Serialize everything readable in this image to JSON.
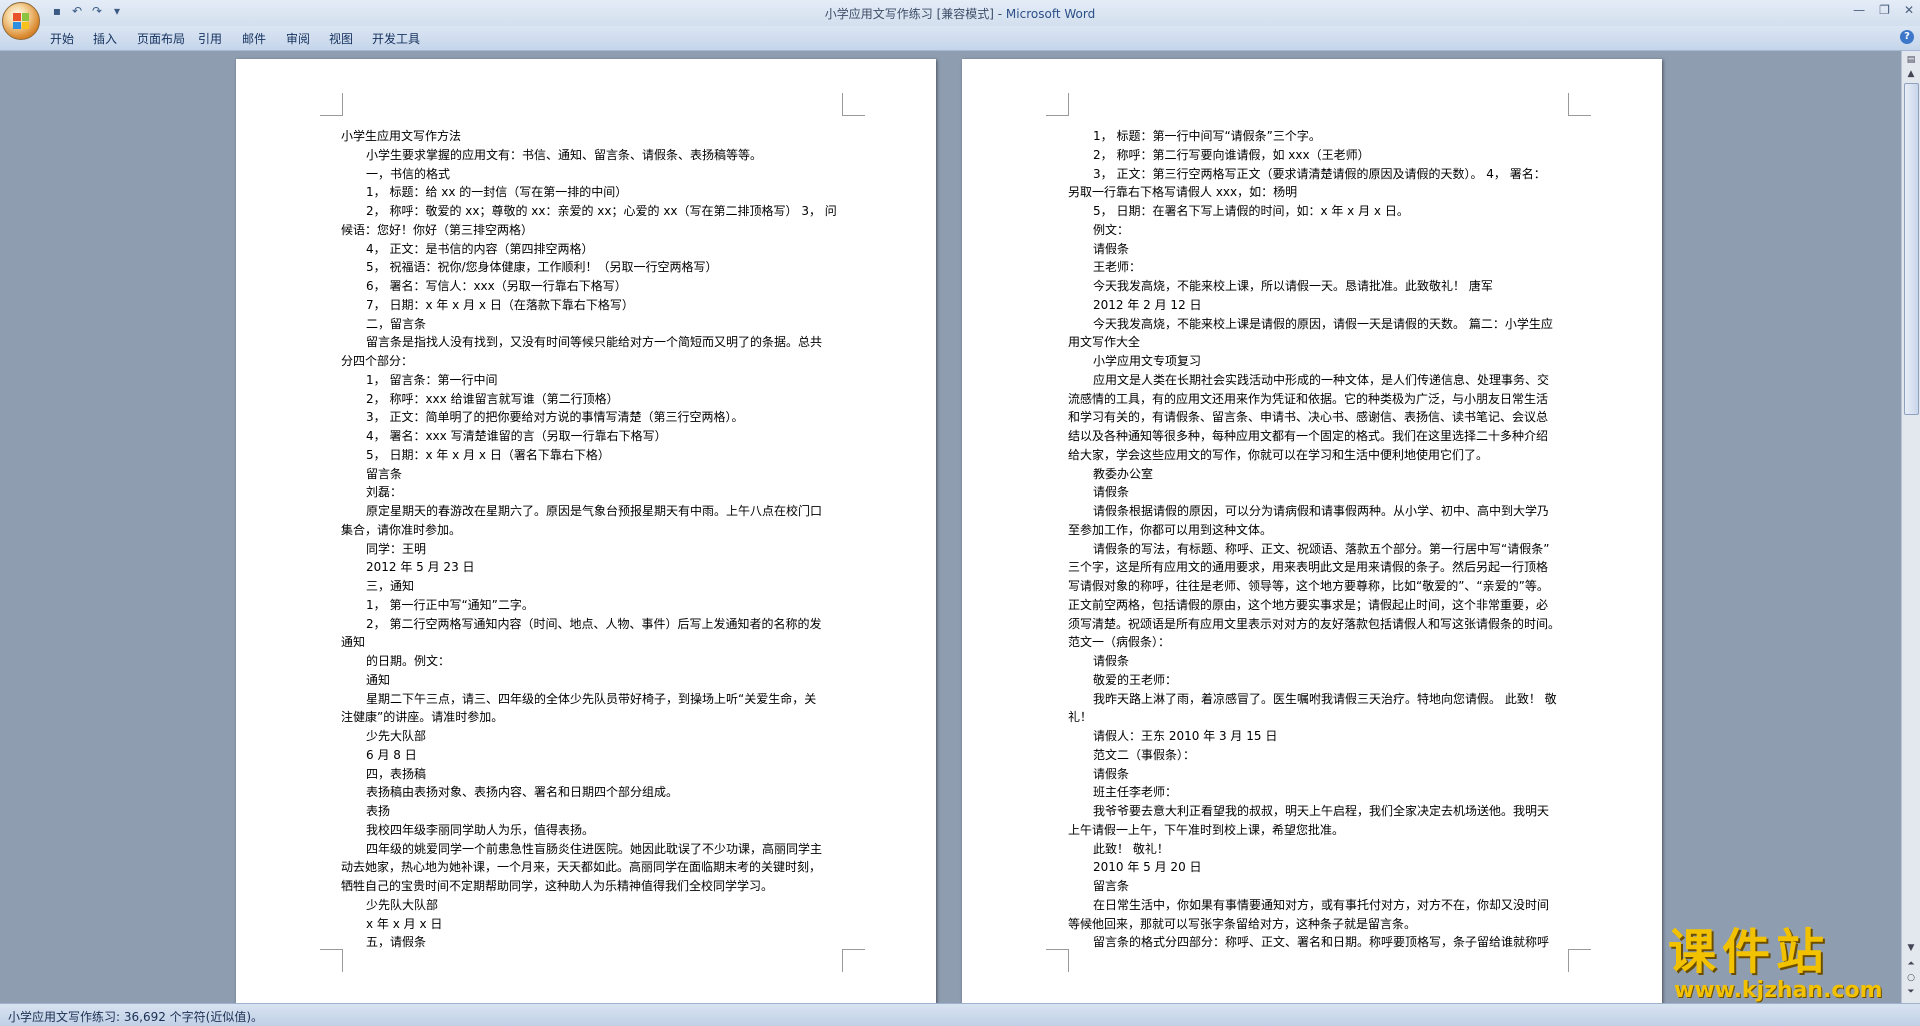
{
  "window": {
    "title_doc": "小学应用文写作练习 [兼容模式] - ",
    "title_app": "Microsoft Word"
  },
  "qat": {
    "save": "▪",
    "undo": "↶",
    "redo": "↷",
    "more": "▾"
  },
  "tabs": [
    "开始",
    "插入",
    "页面布局",
    "引用",
    "邮件",
    "审阅",
    "视图",
    "开发工具"
  ],
  "page1": [
    {
      "t": "小学生应用文写作方法",
      "c": ""
    },
    {
      "t": "小学生要求掌握的应用文有：书信、通知、留言条、请假条、表扬稿等等。",
      "c": "ind"
    },
    {
      "t": "一，书信的格式",
      "c": "ind"
    },
    {
      "t": "1， 标题：给 xx 的一封信（写在第一排的中间）",
      "c": "ind"
    },
    {
      "t": "2， 称呼：敬爱的 xx；尊敬的 xx：亲爱的 xx；心爱的 xx（写在第二排顶格写） 3， 问",
      "c": "ind"
    },
    {
      "t": "候语：您好！你好（第三排空两格）",
      "c": ""
    },
    {
      "t": "4， 正文：是书信的内容（第四排空两格）",
      "c": "ind"
    },
    {
      "t": "5， 祝福语：祝你/您身体健康，工作顺利！（另取一行空两格写）",
      "c": "ind"
    },
    {
      "t": "6， 署名：写信人：xxx（另取一行靠右下格写）",
      "c": "ind"
    },
    {
      "t": "7， 日期：x 年 x 月 x 日（在落款下靠右下格写）",
      "c": "ind"
    },
    {
      "t": "二，留言条",
      "c": "ind"
    },
    {
      "t": "留言条是指找人没有找到，又没有时间等候只能给对方一个简短而又明了的条据。总共",
      "c": "ind"
    },
    {
      "t": "分四个部分：",
      "c": ""
    },
    {
      "t": "1， 留言条：第一行中间",
      "c": "ind"
    },
    {
      "t": "2， 称呼：xxx 给谁留言就写谁（第二行顶格）",
      "c": "ind"
    },
    {
      "t": "3， 正文：简单明了的把你要给对方说的事情写清楚（第三行空两格）。",
      "c": "ind"
    },
    {
      "t": "4， 署名：xxx 写清楚谁留的言（另取一行靠右下格写）",
      "c": "ind"
    },
    {
      "t": "5， 日期：x 年 x 月 x 日（署名下靠右下格）",
      "c": "ind"
    },
    {
      "t": "留言条",
      "c": "ind"
    },
    {
      "t": "刘磊：",
      "c": "ind"
    },
    {
      "t": "原定星期天的春游改在星期六了。原因是气象台预报星期天有中雨。上午八点在校门口",
      "c": "ind"
    },
    {
      "t": "集合，请你准时参加。",
      "c": ""
    },
    {
      "t": "同学：王明",
      "c": "ind"
    },
    {
      "t": "2012 年 5 月 23 日",
      "c": "ind"
    },
    {
      "t": "三，通知",
      "c": "ind"
    },
    {
      "t": "1， 第一行正中写“通知”二字。",
      "c": "ind"
    },
    {
      "t": "2， 第二行空两格写通知内容（时间、地点、人物、事件）后写上发通知者的名称的发",
      "c": "ind"
    },
    {
      "t": "通知",
      "c": ""
    },
    {
      "t": "的日期。例文：",
      "c": "ind"
    },
    {
      "t": "通知",
      "c": "ind"
    },
    {
      "t": "星期二下午三点，请三、四年级的全体少先队员带好椅子，到操场上听“关爱生命，关",
      "c": "ind"
    },
    {
      "t": "注健康”的讲座。请准时参加。",
      "c": ""
    },
    {
      "t": "少先大队部",
      "c": "ind"
    },
    {
      "t": "6 月 8 日",
      "c": "ind"
    },
    {
      "t": "四，表扬稿",
      "c": "ind"
    },
    {
      "t": "表扬稿由表扬对象、表扬内容、署名和日期四个部分组成。",
      "c": "ind"
    },
    {
      "t": "表扬",
      "c": "ind"
    },
    {
      "t": "我校四年级李丽同学助人为乐，值得表扬。",
      "c": "ind"
    },
    {
      "t": "四年级的姚爱同学一个前患急性盲肠炎住进医院。她因此耽误了不少功课，高丽同学主",
      "c": "ind"
    },
    {
      "t": "动去她家，热心地为她补课，一个月来，天天都如此。高丽同学在面临期末考的关键时刻，",
      "c": ""
    },
    {
      "t": "牺牲自己的宝贵时间不定期帮助同学，这种助人为乐精神值得我们全校同学学习。",
      "c": ""
    },
    {
      "t": "少先队大队部",
      "c": "ind"
    },
    {
      "t": "x 年 x 月 x 日",
      "c": "ind"
    },
    {
      "t": "五，请假条",
      "c": "ind"
    }
  ],
  "page2": [
    {
      "t": "1， 标题：第一行中间写“请假条”三个字。",
      "c": "ind"
    },
    {
      "t": "2， 称呼：第二行写要向谁请假，如 xxx（王老师）",
      "c": "ind"
    },
    {
      "t": "3， 正文：第三行空两格写正文（要求请清楚请假的原因及请假的天数）。 4， 署名：",
      "c": "ind"
    },
    {
      "t": "另取一行靠右下格写请假人 xxx，如：杨明",
      "c": ""
    },
    {
      "t": "5， 日期：在署名下写上请假的时间，如：x 年 x 月 x 日。",
      "c": "ind"
    },
    {
      "t": "例文：",
      "c": "ind"
    },
    {
      "t": "请假条",
      "c": "ind"
    },
    {
      "t": "王老师：",
      "c": "ind"
    },
    {
      "t": "今天我发高烧，不能来校上课，所以请假一天。恳请批准。此致敬礼！ 唐军",
      "c": "ind"
    },
    {
      "t": "2012 年 2 月 12 日",
      "c": "ind"
    },
    {
      "t": "今天我发高烧，不能来校上课是请假的原因，请假一天是请假的天数。 篇二：小学生应",
      "c": "ind"
    },
    {
      "t": "用文写作大全",
      "c": ""
    },
    {
      "t": "小学应用文专项复习",
      "c": "ind"
    },
    {
      "t": "应用文是人类在长期社会实践活动中形成的一种文体，是人们传递信息、处理事务、交",
      "c": "ind"
    },
    {
      "t": "流感情的工具，有的应用文还用来作为凭证和依据。它的种类极为广泛，与小朋友日常生活",
      "c": ""
    },
    {
      "t": "和学习有关的，有请假条、留言条、申请书、决心书、感谢信、表扬信、读书笔记、会议总",
      "c": ""
    },
    {
      "t": "结以及各种通知等很多种，每种应用文都有一个固定的格式。我们在这里选择二十多种介绍",
      "c": ""
    },
    {
      "t": "给大家，学会这些应用文的写作，你就可以在学习和生活中便利地使用它们了。",
      "c": ""
    },
    {
      "t": "教委办公室",
      "c": "ind"
    },
    {
      "t": "请假条",
      "c": "ind"
    },
    {
      "t": "请假条根据请假的原因，可以分为请病假和请事假两种。从小学、初中、高中到大学乃",
      "c": "ind"
    },
    {
      "t": "至参加工作，你都可以用到这种文体。",
      "c": ""
    },
    {
      "t": "请假条的写法，有标题、称呼、正文、祝颂语、落款五个部分。第一行居中写“请假条”",
      "c": "ind"
    },
    {
      "t": "三个字，这是所有应用文的通用要求，用来表明此文是用来请假的条子。然后另起一行顶格",
      "c": ""
    },
    {
      "t": "写请假对象的称呼，往往是老师、领导等，这个地方要尊称，比如“敬爱的”、“亲爱的”等。",
      "c": ""
    },
    {
      "t": "正文前空两格，包括请假的原由，这个地方要实事求是；请假起止时间，这个非常重要，必",
      "c": ""
    },
    {
      "t": "须写清楚。祝颂语是所有应用文里表示对对方的友好落款包括请假人和写这张请假条的时间。",
      "c": ""
    },
    {
      "t": "范文一（病假条）：",
      "c": ""
    },
    {
      "t": "请假条",
      "c": "ind"
    },
    {
      "t": "敬爱的王老师：",
      "c": "ind"
    },
    {
      "t": "我昨天路上淋了雨，着凉感冒了。医生嘱咐我请假三天治疗。特地向您请假。 此致！ 敬",
      "c": "ind"
    },
    {
      "t": "礼！",
      "c": ""
    },
    {
      "t": "请假人：王东 2010 年 3 月 15 日",
      "c": "ind"
    },
    {
      "t": "范文二（事假条）：",
      "c": "ind"
    },
    {
      "t": "请假条",
      "c": "ind"
    },
    {
      "t": "班主任李老师：",
      "c": "ind"
    },
    {
      "t": "我爷爷要去意大利正看望我的叔叔，明天上午启程，我们全家决定去机场送他。我明天",
      "c": "ind"
    },
    {
      "t": "上午请假一上午，下午准时到校上课，希望您批准。",
      "c": ""
    },
    {
      "t": "此致！ 敬礼！",
      "c": "ind"
    },
    {
      "t": "2010 年 5 月 20 日",
      "c": "ind"
    },
    {
      "t": "留言条",
      "c": "ind"
    },
    {
      "t": "在日常生活中，你如果有事情要通知对方，或有事托付对方，对方不在，你却又没时间",
      "c": "ind"
    },
    {
      "t": "等候他回来，那就可以写张字条留给对方，这种条子就是留言条。",
      "c": ""
    },
    {
      "t": "留言条的格式分四部分：称呼、正文、署名和日期。称呼要顶格写，条子留给谁就称呼",
      "c": "ind"
    }
  ],
  "status": {
    "text": "小学应用文写作练习: 36,692 个字符(近似值)。"
  },
  "watermark": {
    "cn": "课件站",
    "url": "www.kjzhan.com"
  },
  "colors": {
    "ribbon": "#dbe6f4",
    "workspace": "#8f9db1",
    "watermark": "#f2c200"
  }
}
